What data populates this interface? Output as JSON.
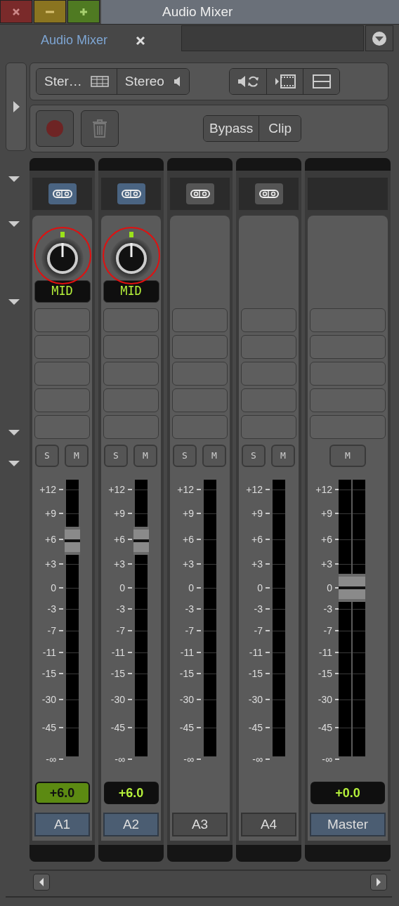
{
  "window": {
    "title": "Audio Mixer",
    "buttons": [
      {
        "kind": "close"
      },
      {
        "kind": "minimize"
      },
      {
        "kind": "zoom"
      }
    ]
  },
  "tabs": [
    {
      "label": "Audio Mixer",
      "selected": true
    }
  ],
  "sidebar": {
    "toggles": [
      {
        "expanded": false
      },
      {
        "expanded": true
      },
      {
        "expanded": true
      },
      {
        "expanded": true
      },
      {
        "expanded": true
      },
      {
        "expanded": true
      }
    ]
  },
  "toolbar": {
    "outputs": [
      {
        "label": "Ster…",
        "kind": "grid"
      },
      {
        "label": "Stereo",
        "kind": "speaker"
      }
    ],
    "views": [
      {
        "kind": "speaker-sync"
      },
      {
        "kind": "film"
      },
      {
        "kind": "split"
      }
    ]
  },
  "record_bar": {
    "trash": {
      "disabled": true
    },
    "buttons": [
      "Bypass",
      "Clip"
    ]
  },
  "channels": [
    {
      "name": "A1",
      "kind": "track",
      "selected": true,
      "routing": {
        "selected": true
      },
      "eq": {
        "label": "MID",
        "circled": true
      },
      "buttons": [
        "S",
        "M"
      ],
      "scale": [
        "+12",
        "+9",
        "+6",
        "+3",
        "0",
        "-3",
        "-7",
        "-11",
        "-15",
        "-30",
        "-45",
        "-∞"
      ],
      "fader": {
        "level": 0.78
      },
      "readout": {
        "text": "+6.0",
        "highlighted": true
      }
    },
    {
      "name": "A2",
      "kind": "track",
      "selected": true,
      "routing": {
        "selected": true
      },
      "eq": {
        "label": "MID",
        "circled": true
      },
      "buttons": [
        "S",
        "M"
      ],
      "scale": [
        "+12",
        "+9",
        "+6",
        "+3",
        "0",
        "-3",
        "-7",
        "-11",
        "-15",
        "-30",
        "-45",
        "-∞"
      ],
      "fader": {
        "level": 0.78
      },
      "readout": {
        "text": "+6.0",
        "highlighted": false
      }
    },
    {
      "name": "A3",
      "kind": "track",
      "selected": false,
      "routing": {
        "selected": false
      },
      "buttons": [
        "S",
        "M"
      ],
      "scale": [
        "+12",
        "+9",
        "+6",
        "+3",
        "0",
        "-3",
        "-7",
        "-11",
        "-15",
        "-30",
        "-45",
        "-∞"
      ]
    },
    {
      "name": "A4",
      "kind": "track",
      "selected": false,
      "routing": {
        "selected": false
      },
      "buttons": [
        "S",
        "M"
      ],
      "scale": [
        "+12",
        "+9",
        "+6",
        "+3",
        "0",
        "-3",
        "-7",
        "-11",
        "-15",
        "-30",
        "-45",
        "-∞"
      ]
    },
    {
      "name": "Master",
      "kind": "master",
      "selected": true,
      "buttons": [
        "M"
      ],
      "scale": [
        "+12",
        "+9",
        "+6",
        "+3",
        "0",
        "-3",
        "-7",
        "-11",
        "-15",
        "-30",
        "-45",
        "-∞"
      ],
      "fader": {
        "level": 0.61
      },
      "readout": {
        "text": "+0.0",
        "highlighted": false
      }
    }
  ]
}
